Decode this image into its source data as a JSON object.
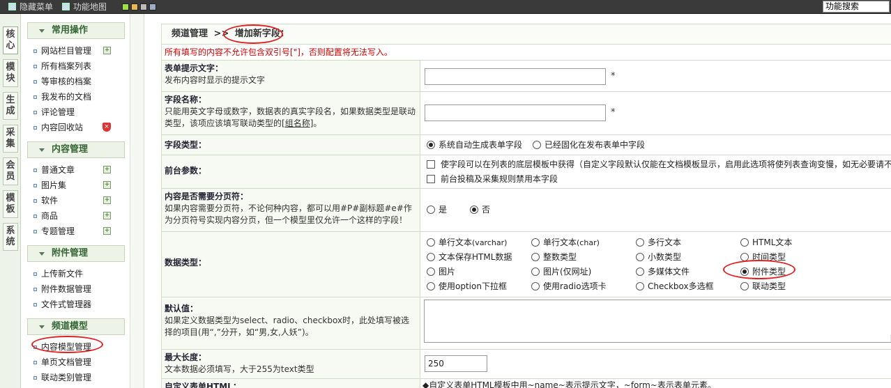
{
  "topbar": {
    "hide_menu": "隐藏菜单",
    "site_map": "功能地图",
    "search_label": "功能搜索"
  },
  "vtabs": [
    "核心",
    "模块",
    "生成",
    "采集",
    "会员",
    "模板",
    "系统"
  ],
  "sidebar": {
    "groups": [
      {
        "title": "常用操作",
        "items": [
          "网站栏目管理",
          "所有档案列表",
          "等审核的档案",
          "我发布的文档",
          "评论管理",
          "内容回收站"
        ]
      },
      {
        "title": "内容管理",
        "items": [
          "普通文章",
          "图片集",
          "软件",
          "商品",
          "专题管理"
        ]
      },
      {
        "title": "附件管理",
        "items": [
          "上传新文件",
          "附件数据管理",
          "文件式管理器"
        ]
      },
      {
        "title": "频道模型",
        "items": [
          "内容模型管理",
          "单页文档管理",
          "联动类别管理"
        ]
      }
    ]
  },
  "main": {
    "breadcrumb_root": "频道管理",
    "breadcrumb_sep": ">>",
    "breadcrumb_current": "增加新字段：",
    "warning": "所有填写的内容不允许包含双引号[\"]，否则配置将无法写入。",
    "fields": {
      "prompt": {
        "label": "表单提示文字：",
        "desc": "发布内容时显示的提示文字",
        "value": "",
        "req": "*"
      },
      "name": {
        "label": "字段名称：",
        "desc": "只能用英文字母或数字，数据表的真实字段名，如果数据类型是联动类型，该项应该填写联动类型的",
        "link": "[组名称]",
        "tail": "。",
        "value": "",
        "req": "*"
      },
      "type": {
        "label": "字段类型：",
        "opt1": "系统自动生成表单字段",
        "opt2": "已经固化在发布表单中字段"
      },
      "frontend": {
        "label": "前台参数：",
        "check1": "使字段可以在列表的底层模板中获得（自定义字段默认仅能在文档模板显示，启用此选项将使列表查询变慢，如无必要请不要",
        "check2": "前台投稿及采集规则禁用本字段"
      },
      "paging": {
        "label": "内容是否需要分页符：",
        "desc": "如果内容需要分页符，不论何种内容，都可以用#P#副标题#e#作为分页符号实现内容分页，但一个模型里仅允许一个这样的字段！",
        "yes": "是",
        "no": "否"
      },
      "datatype": {
        "label": "数据类型：",
        "options": [
          [
            "单行文本",
            "(varchar)"
          ],
          [
            "单行文本",
            "(char)"
          ],
          [
            "多行文本",
            ""
          ],
          [
            "HTML文本",
            ""
          ],
          [
            "文本保存HTML数据",
            ""
          ],
          [
            "整数类型",
            ""
          ],
          [
            "小数类型",
            ""
          ],
          [
            "时间类型",
            ""
          ],
          [
            "图片",
            ""
          ],
          [
            "图片(仅网址)",
            ""
          ],
          [
            "多媒体文件",
            ""
          ],
          [
            "附件类型",
            ""
          ],
          [
            "使用option下拉框",
            ""
          ],
          [
            "使用radio选项卡",
            ""
          ],
          [
            "Checkbox多选框",
            ""
          ],
          [
            "联动类型",
            ""
          ]
        ]
      },
      "default": {
        "label": "默认值：",
        "desc": "如果定义数据类型为select、radio、checkbox时，此处填写被选择的项目(用“,”分开，如“男,女,人妖”)。"
      },
      "maxlen": {
        "label": "最大长度：",
        "desc": "文本数据必须填写，大于255为text类型",
        "value": "250"
      },
      "customhtml": {
        "label": "自定义表单HTML：",
        "hint": "◆自定义表单HTML模板中用~name~表示提示文字，~form~表示表单元素。"
      }
    }
  }
}
